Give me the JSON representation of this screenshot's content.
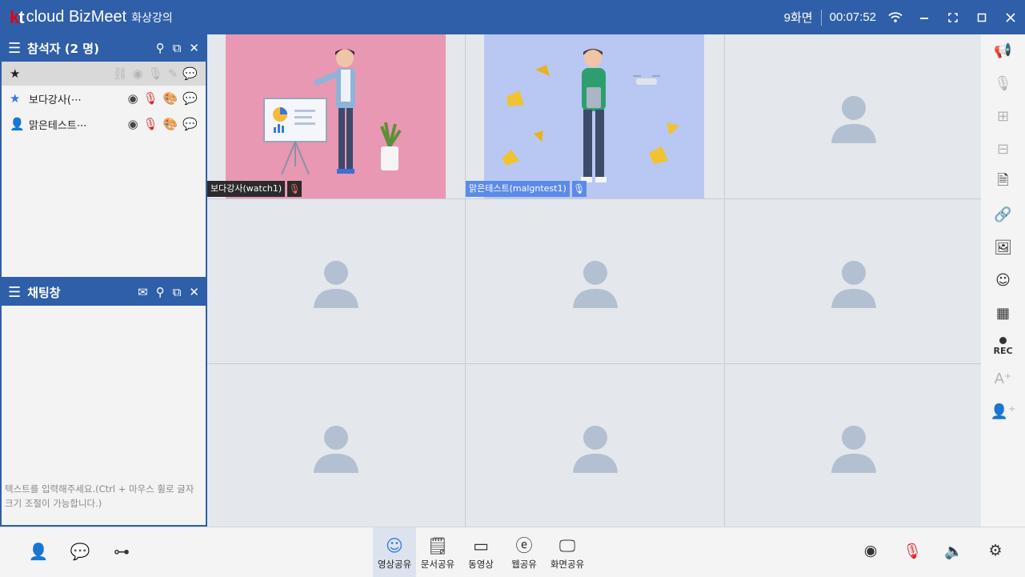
{
  "titlebar": {
    "brand_kt": "kt",
    "brand_product": "cloud BizMeet",
    "subtitle": "화상강의",
    "layout": "9화면",
    "timer": "00:07:52",
    "icons": [
      "wifi-icon",
      "minimize-icon",
      "fit-screen-icon",
      "maximize-icon",
      "close-icon"
    ],
    "icon_glyphs": [
      "≋",
      "−",
      "⛶",
      "□",
      "✕"
    ]
  },
  "participants_panel": {
    "title": "참석자 (2 명)",
    "participants": [
      {
        "name": "보다강사(⋯",
        "role": "host"
      },
      {
        "name": "맑은테스트⋯",
        "role": "guest"
      }
    ]
  },
  "chat_panel": {
    "title": "채팅창",
    "placeholder": "텍스트를 입력해주세요.(Ctrl + 마우스 휠로 글자 크기 조절이 가능합니다.)"
  },
  "video_grid": {
    "tiles": [
      {
        "label": "보다강사(watch1)",
        "has_video": true,
        "theme": "pink"
      },
      {
        "label": "맑은테스트(malgntest1)",
        "has_video": true,
        "theme": "blue"
      },
      {
        "label": "",
        "has_video": false
      },
      {
        "label": "",
        "has_video": false
      },
      {
        "label": "",
        "has_video": false
      },
      {
        "label": "",
        "has_video": false
      },
      {
        "label": "",
        "has_video": false
      },
      {
        "label": "",
        "has_video": false
      },
      {
        "label": "",
        "has_video": false
      }
    ]
  },
  "right_toolbar": {
    "items": [
      "announce-icon",
      "mic-all-icon",
      "grid-layout-icon",
      "layout-pin-icon",
      "document-icon",
      "link-icon",
      "portrait-icon",
      "emoji-icon",
      "mosaic-icon",
      "record-button",
      "text-size-icon",
      "add-user-icon"
    ],
    "rec_label": "REC"
  },
  "bottombar": {
    "left_icons": [
      "person-icon",
      "chat-icon",
      "tree-icon"
    ],
    "tools": [
      {
        "label": "영상공유",
        "icon": "smile-icon",
        "active": true
      },
      {
        "label": "문서공유",
        "icon": "doc-share-icon",
        "active": false
      },
      {
        "label": "동영상",
        "icon": "video-icon",
        "active": false
      },
      {
        "label": "웹공유",
        "icon": "web-icon",
        "active": false
      },
      {
        "label": "화면공유",
        "icon": "screen-share-icon",
        "active": false
      }
    ],
    "right_icons": [
      "webcam-icon",
      "mic-muted-icon",
      "speaker-icon",
      "settings-icon"
    ]
  },
  "colors": {
    "primary": "#2f5fa8",
    "accent_blue": "#2f7de0",
    "muted_red": "#d6262b",
    "tile_bg": "#e4e7ec",
    "avatar": "#b3c0d1"
  }
}
